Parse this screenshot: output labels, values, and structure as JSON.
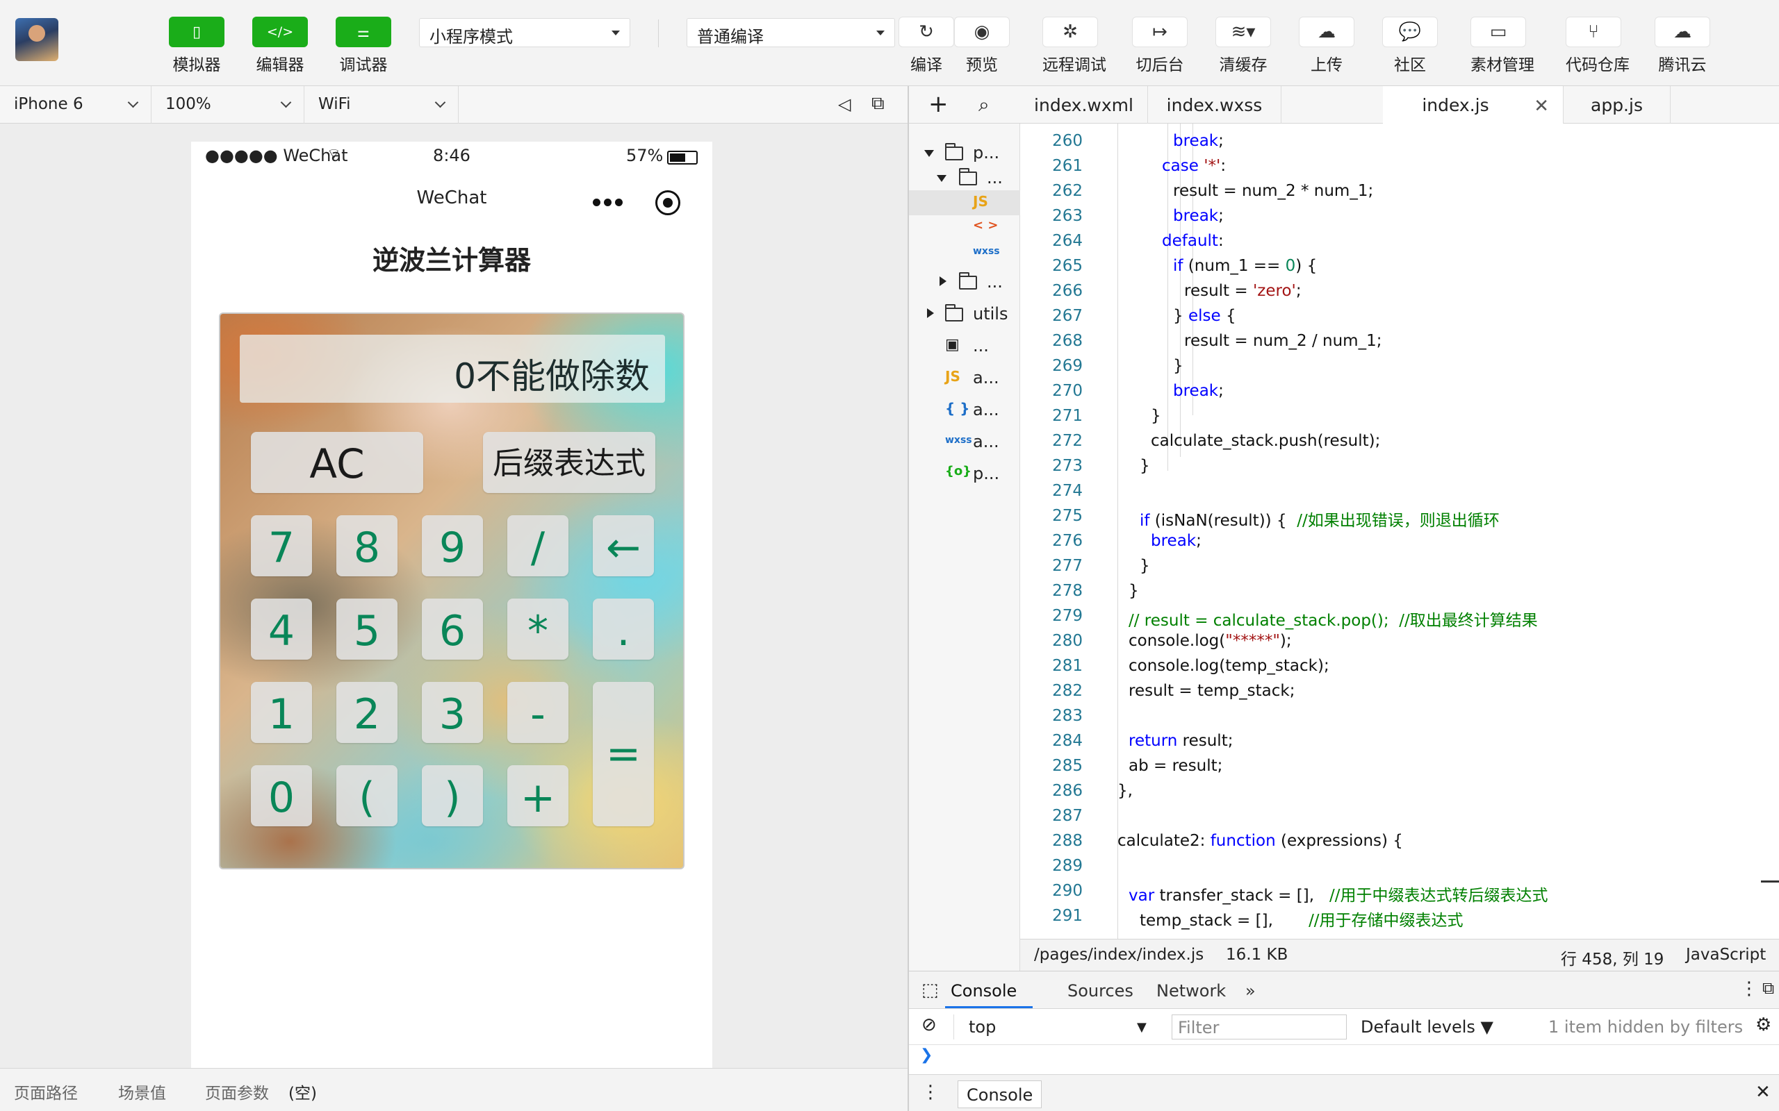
{
  "toolbar": {
    "simulator": "模拟器",
    "editor": "编辑器",
    "debugger": "调试器",
    "mode_select": "小程序模式",
    "compile_select": "普通编译",
    "compile": "编译",
    "preview": "预览",
    "remote_debug": "远程调试",
    "background": "切后台",
    "clear_cache": "清缓存",
    "upload": "上传",
    "community": "社区",
    "assets": "素材管理",
    "repo": "代码仓库",
    "tencent_cloud": "腾讯云"
  },
  "simbar": {
    "device": "iPhone 6",
    "zoom": "100%",
    "network": "WiFi"
  },
  "phone": {
    "carrier": "●●●●● WeChat",
    "time": "8:46",
    "battery": "57%",
    "nav_title": "WeChat",
    "app_title": "逆波兰计算器",
    "display": "0不能做除数",
    "btn_ac": "AC",
    "btn_postfix": "后缀表达式",
    "keys": [
      "7",
      "8",
      "9",
      "/",
      "←",
      "4",
      "5",
      "6",
      "*",
      ".",
      "1",
      "2",
      "3",
      "-",
      "=",
      "0",
      "(",
      ")",
      "+"
    ]
  },
  "sim_bottom": {
    "path": "页面路径",
    "scene": "场景值",
    "params": "页面参数",
    "params_value": "(空)"
  },
  "tree": {
    "items": [
      "p...",
      "...",
      "JS",
      "< >",
      "wxss",
      "...",
      "utils",
      "...",
      "a...",
      "a...",
      "a...",
      "p..."
    ]
  },
  "tabs": [
    "index.wxml",
    "index.wxss",
    "index.js",
    "app.js"
  ],
  "code": {
    "line_numbers": [
      "260",
      "261",
      "262",
      "263",
      "264",
      "265",
      "266",
      "267",
      "268",
      "269",
      "270",
      "271",
      "272",
      "273",
      "274",
      "275",
      "276",
      "277",
      "278",
      "279",
      "280",
      "281",
      "282",
      "283",
      "284",
      "285",
      "286",
      "287",
      "288",
      "289",
      "290",
      "291"
    ]
  },
  "statusline": {
    "path": "/pages/index/index.js",
    "size": "16.1 KB",
    "position": "行 458, 列 19",
    "language": "JavaScript"
  },
  "devtools": {
    "tabs": [
      "Console",
      "Sources",
      "Network",
      "»"
    ],
    "context": "top",
    "filter_placeholder": "Filter",
    "levels": "Default levels ▼",
    "hidden": "1 item hidden by filters",
    "drawer_tab": "Console"
  }
}
